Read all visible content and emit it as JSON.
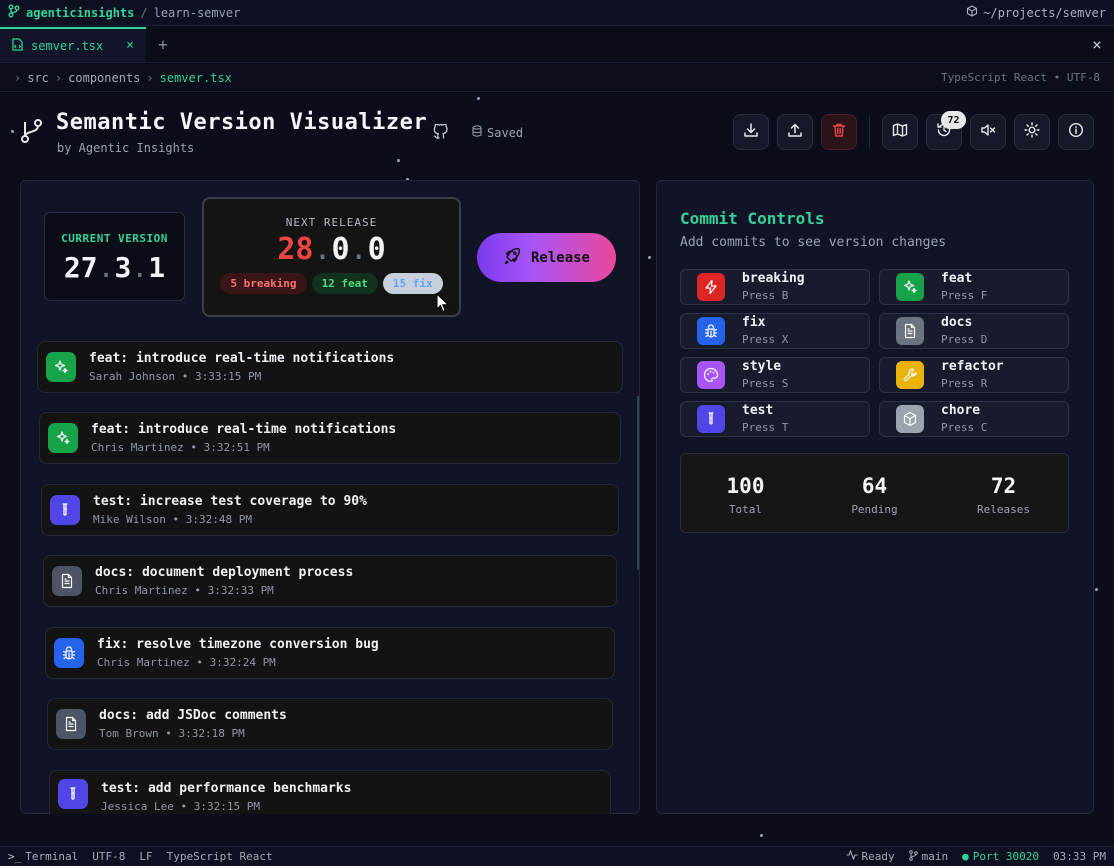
{
  "titlebar": {
    "repo": "agenticinsights",
    "separator": "/",
    "project": "learn-semver",
    "path": "~/projects/semver"
  },
  "tabs": {
    "active_label": "semver.tsx",
    "close": "×",
    "new": "+",
    "close_all": "×"
  },
  "breadcrumb": {
    "items": [
      "src",
      "components",
      "semver.tsx"
    ],
    "meta": "TypeScript React • UTF-8"
  },
  "header": {
    "title": "Semantic Version Visualizer",
    "subtitle": "by Agentic Insights",
    "saved": "Saved",
    "history_badge": "72"
  },
  "version": {
    "current_label": "CURRENT VERSION",
    "current": {
      "major": "27",
      "minor": "3",
      "patch": "1"
    },
    "next_label": "NEXT RELEASE",
    "next": {
      "major": "28",
      "minor": "0",
      "patch": "0"
    },
    "chips": {
      "breaking": "5 breaking",
      "feat": "12 feat",
      "fix": "15 fix"
    },
    "release_label": "Release"
  },
  "commits": [
    {
      "type": "feat",
      "message": "feat: introduce real-time notifications",
      "meta": "Sarah Johnson • 3:33:15 PM"
    },
    {
      "type": "feat",
      "message": "feat: introduce real-time notifications",
      "meta": "Chris Martinez • 3:32:51 PM"
    },
    {
      "type": "test",
      "message": "test: increase test coverage to 90%",
      "meta": "Mike Wilson • 3:32:48 PM"
    },
    {
      "type": "docs",
      "message": "docs: document deployment process",
      "meta": "Chris Martinez • 3:32:33 PM"
    },
    {
      "type": "fix",
      "message": "fix: resolve timezone conversion bug",
      "meta": "Chris Martinez • 3:32:24 PM"
    },
    {
      "type": "docs",
      "message": "docs: add JSDoc comments",
      "meta": "Tom Brown • 3:32:18 PM"
    },
    {
      "type": "test",
      "message": "test: add performance benchmarks",
      "meta": "Jessica Lee • 3:32:15 PM"
    }
  ],
  "controls": {
    "title": "Commit Controls",
    "subtitle": "Add commits to see version changes",
    "types": [
      {
        "name": "breaking",
        "key": "Press B",
        "color": "#dc2626",
        "icon": "zap-icon"
      },
      {
        "name": "feat",
        "key": "Press F",
        "color": "#16a34a",
        "icon": "sparkles-icon"
      },
      {
        "name": "fix",
        "key": "Press X",
        "color": "#2563eb",
        "icon": "bug-icon"
      },
      {
        "name": "docs",
        "key": "Press D",
        "color": "#6b7280",
        "icon": "document-icon"
      },
      {
        "name": "style",
        "key": "Press S",
        "color": "#a855f7",
        "icon": "palette-icon"
      },
      {
        "name": "refactor",
        "key": "Press R",
        "color": "#eab308",
        "icon": "wrench-icon"
      },
      {
        "name": "test",
        "key": "Press T",
        "color": "#4f46e5",
        "icon": "test-tube-icon"
      },
      {
        "name": "chore",
        "key": "Press C",
        "color": "#9ca3af",
        "icon": "package-icon"
      }
    ]
  },
  "stats": [
    {
      "value": "100",
      "label": "Total"
    },
    {
      "value": "64",
      "label": "Pending"
    },
    {
      "value": "72",
      "label": "Releases"
    }
  ],
  "statusbar": {
    "terminal": "Terminal",
    "encoding": "UTF-8",
    "eol": "LF",
    "language": "TypeScript React",
    "ready": "Ready",
    "branch": "main",
    "port": "Port 30020",
    "time": "03:33 PM"
  }
}
